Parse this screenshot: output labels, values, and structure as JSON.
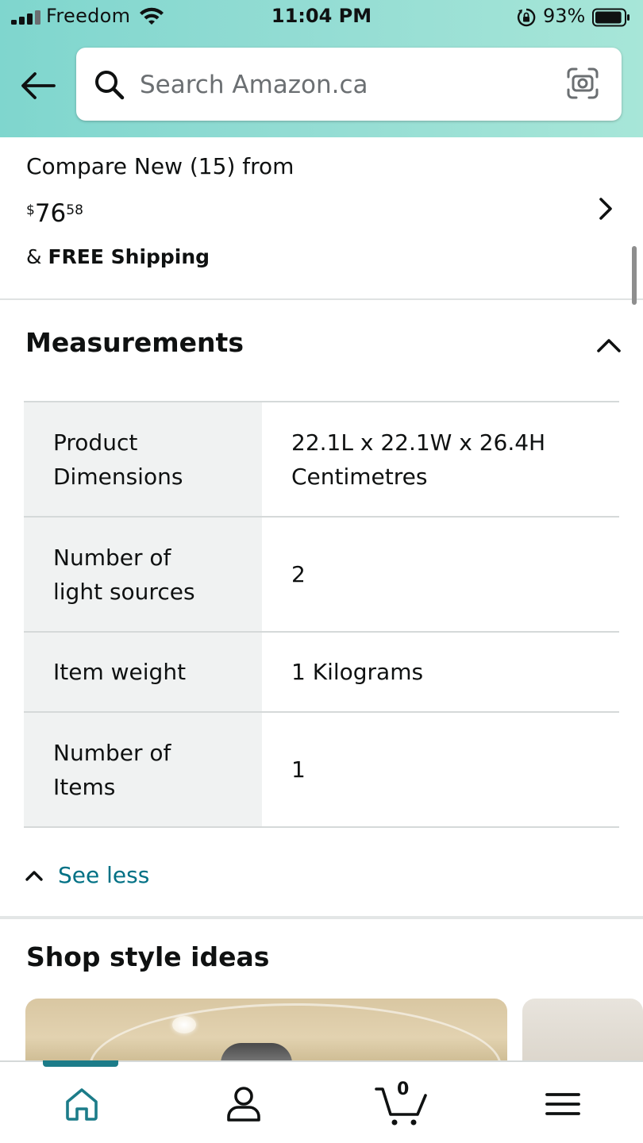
{
  "status_bar": {
    "carrier": "Freedom",
    "time": "11:04 PM",
    "battery_percent": "93%",
    "battery_level": 0.93
  },
  "header": {
    "back_icon": "back-arrow-icon",
    "search": {
      "placeholder": "Search Amazon.ca",
      "value": ""
    },
    "camera_icon": "camera-scan-icon"
  },
  "compare_offer": {
    "label": "Compare New (15) from",
    "price_symbol": "$",
    "price_whole": "76",
    "price_fraction": "58",
    "shipping_prefix": "& ",
    "shipping_bold": "FREE Shipping"
  },
  "measurements": {
    "title": "Measurements",
    "rows": [
      {
        "label_line1": "Product",
        "label_line2": "Dimensions",
        "value_line1": "22.1L x 22.1W x 26.4H",
        "value_line2": "Centimetres"
      },
      {
        "label_line1": "Number of",
        "label_line2": "light sources",
        "value_line1": "2",
        "value_line2": ""
      },
      {
        "label_line1": "Item weight",
        "label_line2": "",
        "value_line1": "1 Kilograms",
        "value_line2": ""
      },
      {
        "label_line1": "Number of",
        "label_line2": "Items",
        "value_line1": "1",
        "value_line2": ""
      }
    ],
    "see_less": "See less"
  },
  "style_ideas": {
    "title": "Shop style ideas"
  },
  "bottom_nav": {
    "items": [
      {
        "name": "home",
        "icon": "home-icon",
        "active": true
      },
      {
        "name": "account",
        "icon": "user-icon",
        "active": false
      },
      {
        "name": "cart",
        "icon": "cart-icon",
        "count": "0",
        "active": false
      },
      {
        "name": "menu",
        "icon": "hamburger-menu-icon",
        "active": false
      }
    ]
  },
  "colors": {
    "header_gradient_start": "#7fd6ce",
    "header_gradient_end": "#a7e6d8",
    "link": "#007185",
    "active_tab": "#1c7c89",
    "spec_label_bg": "#f0f2f2"
  }
}
